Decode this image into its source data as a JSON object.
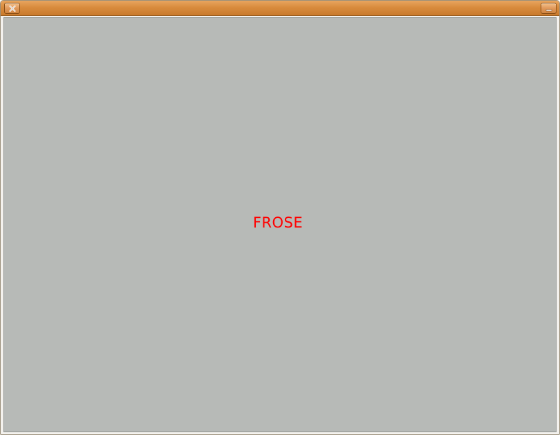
{
  "window": {
    "titlebar": {
      "close_icon": "close-icon",
      "minimize_icon": "minimize-icon"
    },
    "client": {
      "background_color": "#b7bab7",
      "label": "FROSE",
      "label_color": "#ff0000"
    }
  }
}
